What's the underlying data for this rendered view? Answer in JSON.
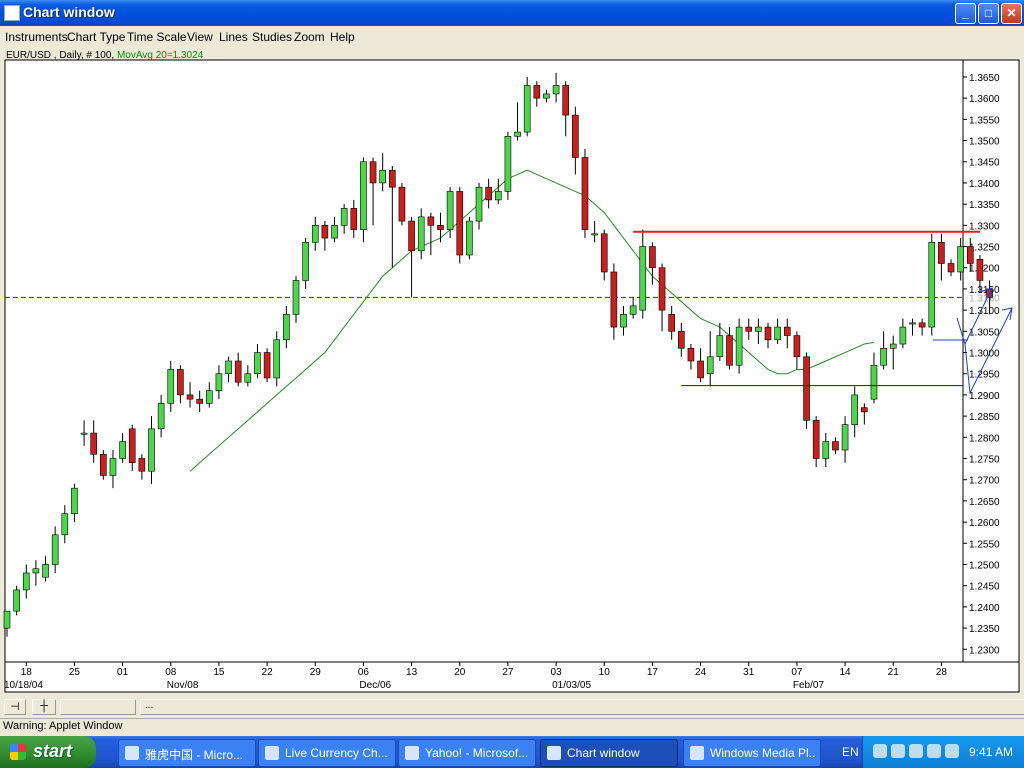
{
  "window": {
    "title": "Chart window",
    "min_glyph": "_",
    "max_glyph": "□",
    "close_glyph": "✕"
  },
  "menu": [
    "Instruments",
    "Chart Type",
    "Time Scale",
    "View",
    "Lines",
    "Studies",
    "Zoom",
    "Help"
  ],
  "chart_header": {
    "symbol": "EUR/USD , Daily, # 100,",
    "ma": "MovAvg 20=1.3024"
  },
  "chart_data": {
    "type": "candlestick",
    "instrument": "EUR/USD",
    "ylim": [
      1.227,
      1.369
    ],
    "y_ticks": [
      "1.3650",
      "1.3600",
      "1.3550",
      "1.3500",
      "1.3450",
      "1.3400",
      "1.3350",
      "1.3300",
      "1.3250",
      "1.3200",
      "1.3150",
      "1.3100",
      "1.3050",
      "1.3000",
      "1.2950",
      "1.2900",
      "1.2850",
      "1.2800",
      "1.2750",
      "1.2700",
      "1.2650",
      "1.2600",
      "1.2550",
      "1.2500",
      "1.2450",
      "1.2400",
      "1.2350",
      "1.2300"
    ],
    "y_tick_values": [
      1.365,
      1.36,
      1.355,
      1.35,
      1.345,
      1.34,
      1.335,
      1.33,
      1.325,
      1.32,
      1.315,
      1.31,
      1.305,
      1.3,
      1.295,
      1.29,
      1.285,
      1.28,
      1.275,
      1.27,
      1.265,
      1.26,
      1.255,
      1.25,
      1.245,
      1.24,
      1.235,
      1.23
    ],
    "x_day_labels": [
      {
        "label": "18",
        "i": 2
      },
      {
        "label": "25",
        "i": 7
      },
      {
        "label": "01",
        "i": 12
      },
      {
        "label": "08",
        "i": 17
      },
      {
        "label": "15",
        "i": 22
      },
      {
        "label": "22",
        "i": 27
      },
      {
        "label": "29",
        "i": 32
      },
      {
        "label": "06",
        "i": 37
      },
      {
        "label": "13",
        "i": 42
      },
      {
        "label": "20",
        "i": 47
      },
      {
        "label": "27",
        "i": 52
      },
      {
        "label": "03",
        "i": 57
      },
      {
        "label": "10",
        "i": 62
      },
      {
        "label": "17",
        "i": 67
      },
      {
        "label": "24",
        "i": 72
      },
      {
        "label": "31",
        "i": 77
      },
      {
        "label": "07",
        "i": 82
      },
      {
        "label": "14",
        "i": 87
      },
      {
        "label": "21",
        "i": 92
      },
      {
        "label": "28",
        "i": 97
      }
    ],
    "x_month_labels": [
      {
        "label": "10/18/04",
        "i": 0
      },
      {
        "label": "Nov/08",
        "i": 17
      },
      {
        "label": "Dec/06",
        "i": 37
      },
      {
        "label": "01/03/05",
        "i": 57
      },
      {
        "label": "Feb/07",
        "i": 82
      }
    ],
    "candles": [
      [
        1.235,
        1.239,
        1.236,
        1.233
      ],
      [
        1.239,
        1.244,
        1.245,
        1.238
      ],
      [
        1.244,
        1.248,
        1.25,
        1.242
      ],
      [
        1.248,
        1.249,
        1.251,
        1.245
      ],
      [
        1.247,
        1.25,
        1.252,
        1.246
      ],
      [
        1.25,
        1.257,
        1.259,
        1.248
      ],
      [
        1.257,
        1.262,
        1.264,
        1.255
      ],
      [
        1.262,
        1.268,
        1.269,
        1.26
      ],
      [
        1.281,
        1.281,
        1.284,
        1.278
      ],
      [
        1.281,
        1.276,
        1.284,
        1.274
      ],
      [
        1.276,
        1.271,
        1.277,
        1.27
      ],
      [
        1.271,
        1.275,
        1.277,
        1.268
      ],
      [
        1.275,
        1.279,
        1.281,
        1.274
      ],
      [
        1.282,
        1.274,
        1.283,
        1.272
      ],
      [
        1.275,
        1.272,
        1.276,
        1.27
      ],
      [
        1.272,
        1.282,
        1.285,
        1.269
      ],
      [
        1.282,
        1.288,
        1.29,
        1.28
      ],
      [
        1.288,
        1.296,
        1.298,
        1.286
      ],
      [
        1.296,
        1.29,
        1.297,
        1.288
      ],
      [
        1.29,
        1.289,
        1.293,
        1.287
      ],
      [
        1.289,
        1.288,
        1.291,
        1.286
      ],
      [
        1.288,
        1.291,
        1.293,
        1.287
      ],
      [
        1.291,
        1.295,
        1.297,
        1.289
      ],
      [
        1.295,
        1.298,
        1.299,
        1.293
      ],
      [
        1.298,
        1.293,
        1.3,
        1.292
      ],
      [
        1.293,
        1.295,
        1.297,
        1.292
      ],
      [
        1.295,
        1.3,
        1.302,
        1.294
      ],
      [
        1.3,
        1.294,
        1.301,
        1.293
      ],
      [
        1.294,
        1.303,
        1.305,
        1.292
      ],
      [
        1.303,
        1.309,
        1.311,
        1.301
      ],
      [
        1.309,
        1.317,
        1.318,
        1.307
      ],
      [
        1.317,
        1.326,
        1.327,
        1.315
      ],
      [
        1.326,
        1.33,
        1.332,
        1.324
      ],
      [
        1.33,
        1.327,
        1.331,
        1.324
      ],
      [
        1.327,
        1.33,
        1.332,
        1.326
      ],
      [
        1.33,
        1.334,
        1.335,
        1.328
      ],
      [
        1.334,
        1.329,
        1.336,
        1.327
      ],
      [
        1.329,
        1.345,
        1.346,
        1.326
      ],
      [
        1.345,
        1.34,
        1.346,
        1.33
      ],
      [
        1.34,
        1.343,
        1.347,
        1.338
      ],
      [
        1.343,
        1.339,
        1.344,
        1.32
      ],
      [
        1.339,
        1.331,
        1.34,
        1.33
      ],
      [
        1.331,
        1.324,
        1.332,
        1.313
      ],
      [
        1.324,
        1.332,
        1.334,
        1.322
      ],
      [
        1.332,
        1.33,
        1.333,
        1.323
      ],
      [
        1.33,
        1.329,
        1.333,
        1.326
      ],
      [
        1.329,
        1.338,
        1.339,
        1.327
      ],
      [
        1.338,
        1.323,
        1.339,
        1.321
      ],
      [
        1.323,
        1.331,
        1.332,
        1.322
      ],
      [
        1.331,
        1.339,
        1.34,
        1.329
      ],
      [
        1.339,
        1.336,
        1.341,
        1.334
      ],
      [
        1.336,
        1.338,
        1.341,
        1.335
      ],
      [
        1.338,
        1.351,
        1.352,
        1.336
      ],
      [
        1.351,
        1.352,
        1.359,
        1.35
      ],
      [
        1.352,
        1.363,
        1.365,
        1.351
      ],
      [
        1.363,
        1.36,
        1.364,
        1.358
      ],
      [
        1.36,
        1.361,
        1.362,
        1.359
      ],
      [
        1.361,
        1.363,
        1.366,
        1.359
      ],
      [
        1.363,
        1.356,
        1.364,
        1.351
      ],
      [
        1.356,
        1.346,
        1.358,
        1.342
      ],
      [
        1.346,
        1.329,
        1.348,
        1.327
      ],
      [
        1.328,
        1.328,
        1.331,
        1.326
      ],
      [
        1.328,
        1.319,
        1.329,
        1.317
      ],
      [
        1.319,
        1.306,
        1.321,
        1.303
      ],
      [
        1.306,
        1.309,
        1.311,
        1.304
      ],
      [
        1.309,
        1.311,
        1.313,
        1.308
      ],
      [
        1.31,
        1.325,
        1.329,
        1.308
      ],
      [
        1.325,
        1.32,
        1.326,
        1.316
      ],
      [
        1.32,
        1.31,
        1.321,
        1.305
      ],
      [
        1.309,
        1.305,
        1.311,
        1.303
      ],
      [
        1.305,
        1.301,
        1.307,
        1.299
      ],
      [
        1.301,
        1.298,
        1.302,
        1.296
      ],
      [
        1.298,
        1.294,
        1.301,
        1.293
      ],
      [
        1.295,
        1.299,
        1.305,
        1.292
      ],
      [
        1.299,
        1.304,
        1.307,
        1.298
      ],
      [
        1.304,
        1.297,
        1.306,
        1.296
      ],
      [
        1.297,
        1.306,
        1.308,
        1.295
      ],
      [
        1.306,
        1.305,
        1.308,
        1.303
      ],
      [
        1.305,
        1.306,
        1.308,
        1.302
      ],
      [
        1.306,
        1.303,
        1.307,
        1.301
      ],
      [
        1.303,
        1.306,
        1.308,
        1.302
      ],
      [
        1.306,
        1.304,
        1.308,
        1.301
      ],
      [
        1.304,
        1.299,
        1.305,
        1.296
      ],
      [
        1.299,
        1.284,
        1.3,
        1.282
      ],
      [
        1.284,
        1.275,
        1.285,
        1.273
      ],
      [
        1.275,
        1.279,
        1.281,
        1.273
      ],
      [
        1.279,
        1.277,
        1.28,
        1.276
      ],
      [
        1.277,
        1.283,
        1.285,
        1.274
      ],
      [
        1.283,
        1.29,
        1.292,
        1.28
      ],
      [
        1.287,
        1.286,
        1.288,
        1.283
      ],
      [
        1.289,
        1.297,
        1.3,
        1.288
      ],
      [
        1.297,
        1.301,
        1.305,
        1.296
      ],
      [
        1.301,
        1.302,
        1.304,
        1.296
      ],
      [
        1.302,
        1.306,
        1.308,
        1.301
      ],
      [
        1.307,
        1.307,
        1.308,
        1.304
      ],
      [
        1.307,
        1.306,
        1.308,
        1.304
      ],
      [
        1.306,
        1.326,
        1.328,
        1.304
      ],
      [
        1.326,
        1.321,
        1.328,
        1.317
      ],
      [
        1.321,
        1.319,
        1.322,
        1.318
      ],
      [
        1.319,
        1.325,
        1.327,
        1.317
      ],
      [
        1.325,
        1.321,
        1.327,
        1.319
      ],
      [
        1.322,
        1.317,
        1.323,
        1.314
      ],
      [
        1.315,
        1.313,
        1.317,
        1.309
      ]
    ],
    "moving_average": {
      "name": "MovAvg 20",
      "color": "#2a8a2a",
      "start_index": 19,
      "values": [
        1.272,
        1.274,
        1.276,
        1.278,
        1.28,
        1.282,
        1.284,
        1.286,
        1.288,
        1.29,
        1.292,
        1.294,
        1.296,
        1.298,
        1.3,
        1.303,
        1.306,
        1.309,
        1.312,
        1.315,
        1.318,
        1.32,
        1.322,
        1.324,
        1.325,
        1.326,
        1.327,
        1.329,
        1.331,
        1.333,
        1.335,
        1.337,
        1.339,
        1.341,
        1.342,
        1.343,
        1.342,
        1.341,
        1.34,
        1.339,
        1.338,
        1.337,
        1.335,
        1.333,
        1.33,
        1.327,
        1.324,
        1.321,
        1.318,
        1.316,
        1.314,
        1.312,
        1.31,
        1.308,
        1.307,
        1.306,
        1.304,
        1.302,
        1.3,
        1.298,
        1.296,
        1.295,
        1.295,
        1.296,
        1.296,
        1.297,
        1.298,
        1.299,
        1.3,
        1.301,
        1.302,
        1.3024
      ]
    },
    "annotations": {
      "resistance": {
        "value": 1.3285,
        "from_index": 65,
        "color": "#e02020"
      },
      "support": {
        "value": 1.2922,
        "from_index": 70,
        "color": "#101880"
      },
      "dashed_level": {
        "value": 1.313,
        "label": "1.3130",
        "color": "#2a2a9a"
      },
      "up_color": "#4cd64c",
      "down_color": "#cc1e1e"
    }
  },
  "status": {
    "warning": "Warning: Applet Window",
    "ellipsis": "..."
  },
  "taskbar": {
    "start": "start",
    "tasks": [
      "雅虎中国 - Micro...",
      "Live Currency Ch...",
      "Yahoo! - Microsof...",
      "Chart window",
      "Windows Media Pl..."
    ],
    "active_task": 3,
    "lang": "EN",
    "clock": "9:41 AM"
  }
}
